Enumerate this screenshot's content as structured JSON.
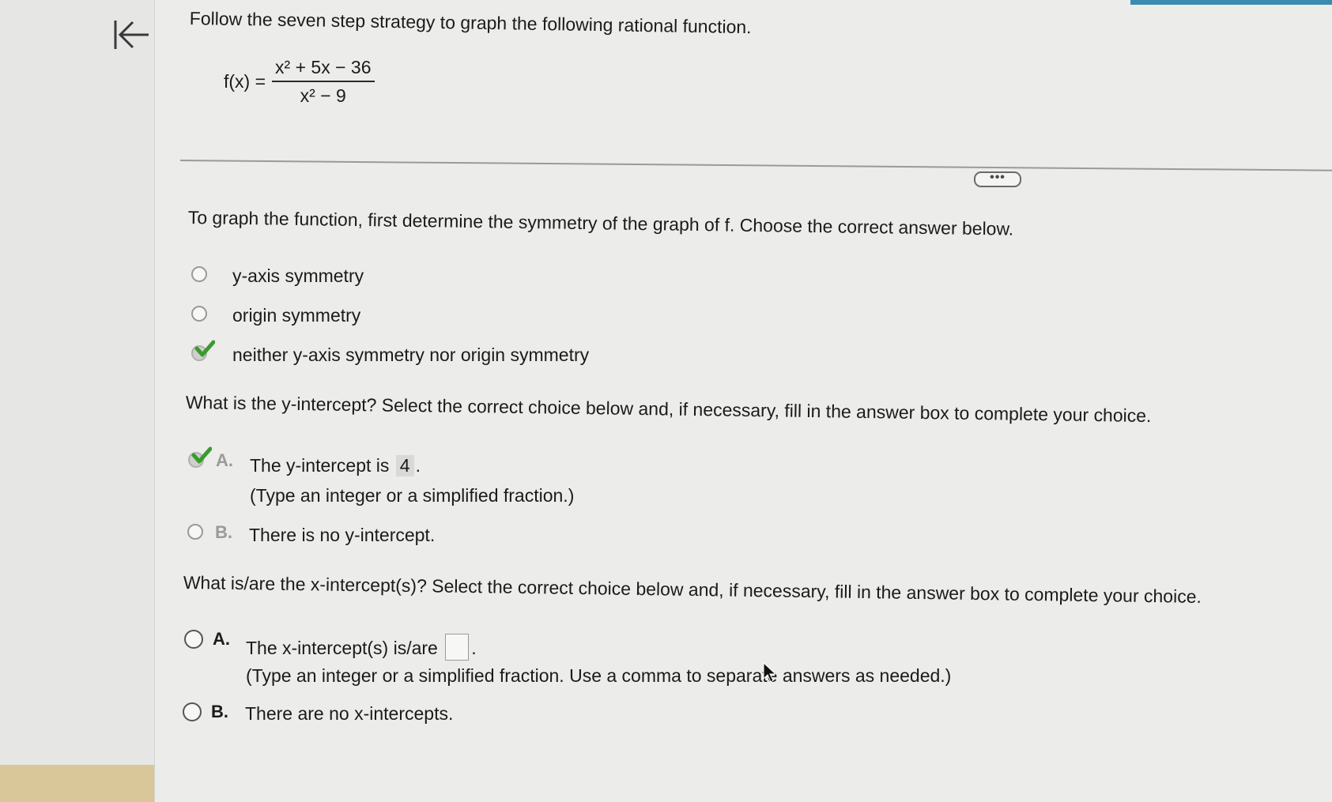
{
  "instruction": "Follow the seven step strategy to graph the following rational function.",
  "formula": {
    "lhs": "f(x) =",
    "numerator": "x² + 5x − 36",
    "denominator": "x² − 9"
  },
  "more_button_label": "•••",
  "q1": {
    "prompt": "To graph the function, first determine the symmetry of the graph of f. Choose the correct answer below.",
    "options": [
      {
        "label": "y-axis symmetry",
        "selected": false
      },
      {
        "label": "origin symmetry",
        "selected": false
      },
      {
        "label": "neither y-axis symmetry nor origin symmetry",
        "selected": true,
        "status": "correct"
      }
    ]
  },
  "q2": {
    "prompt": "What is the y-intercept? Select the correct choice below and, if necessary, fill in the answer box to complete your choice.",
    "choiceA": {
      "letter": "A.",
      "text": "The y-intercept is",
      "value": "4",
      "period": ".",
      "hint": "(Type an integer or a simplified fraction.)",
      "selected": true,
      "status": "correct"
    },
    "choiceB": {
      "letter": "B.",
      "text": "There is no y-intercept.",
      "selected": false
    }
  },
  "q3": {
    "prompt": "What is/are the x-intercept(s)? Select the correct choice below and, if necessary, fill in the answer box to complete your choice.",
    "choiceA": {
      "letter": "A.",
      "text": "The x-intercept(s) is/are",
      "value": "",
      "period": ".",
      "hint": "(Type an integer or a simplified fraction. Use a comma to separate answers as needed.)",
      "selected": false
    },
    "choiceB": {
      "letter": "B.",
      "text": "There are no x-intercepts.",
      "selected": false
    }
  },
  "colors": {
    "check_green": "#3a9a2e",
    "accent_blue": "#3b8ab0",
    "rail_footer": "#d9c79a"
  },
  "icons": {
    "back": "arrow-left-to-line-icon",
    "correct": "check-icon",
    "pointer": "mouse-cursor-icon"
  }
}
